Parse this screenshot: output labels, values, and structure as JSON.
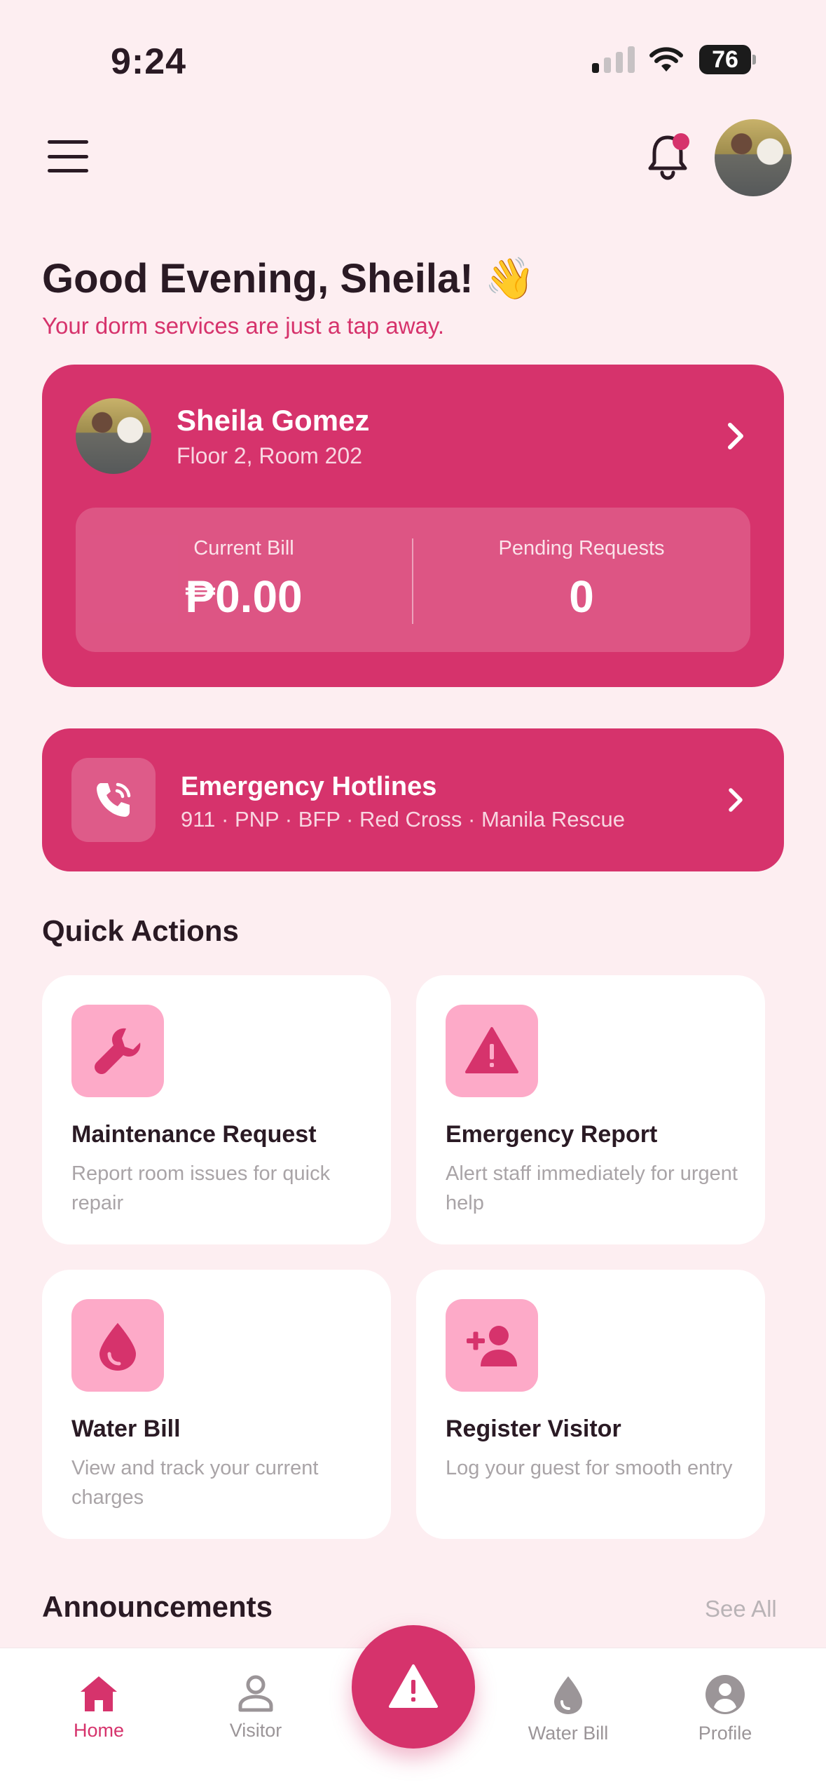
{
  "status_bar": {
    "time": "9:24",
    "battery": "76"
  },
  "header": {
    "menu_icon": "hamburger-menu-icon",
    "bell_icon": "bell-icon",
    "has_notification_dot": true
  },
  "greeting": {
    "title": "Good Evening, Sheila! 👋",
    "subtitle": "Your dorm services are just a tap away."
  },
  "profile_card": {
    "name": "Sheila Gomez",
    "room": "Floor 2, Room 202",
    "stats": [
      {
        "label": "Current Bill",
        "value": "₱0.00"
      },
      {
        "label": "Pending Requests",
        "value": "0"
      }
    ]
  },
  "hotlines": {
    "title": "Emergency Hotlines",
    "subtitle": "911 · PNP · BFP · Red Cross · Manila Rescue",
    "icon": "phone-icon"
  },
  "quick_actions": {
    "title": "Quick Actions",
    "items": [
      {
        "name": "Maintenance Request",
        "desc": "Report room issues for quick repair",
        "icon": "wrench-icon"
      },
      {
        "name": "Emergency Report",
        "desc": "Alert staff immediately for urgent help",
        "icon": "warning-icon"
      },
      {
        "name": "Water Bill",
        "desc": "View and track your current charges",
        "icon": "water-drop-icon"
      },
      {
        "name": "Register Visitor",
        "desc": "Log your guest for smooth entry",
        "icon": "add-person-icon"
      }
    ]
  },
  "announcements": {
    "title": "Announcements",
    "see_all": "See All"
  },
  "bottom_nav": {
    "items": [
      {
        "label": "Home",
        "icon": "home-icon",
        "active": true
      },
      {
        "label": "Visitor",
        "icon": "person-icon",
        "active": false
      },
      {
        "label": "Water Bill",
        "icon": "water-drop-icon",
        "active": false
      },
      {
        "label": "Profile",
        "icon": "profile-icon",
        "active": false
      }
    ],
    "fab_icon": "warning-icon"
  },
  "colors": {
    "accent": "#d6336c",
    "background": "#fdeef1",
    "icon_tile": "#fdaac8"
  }
}
